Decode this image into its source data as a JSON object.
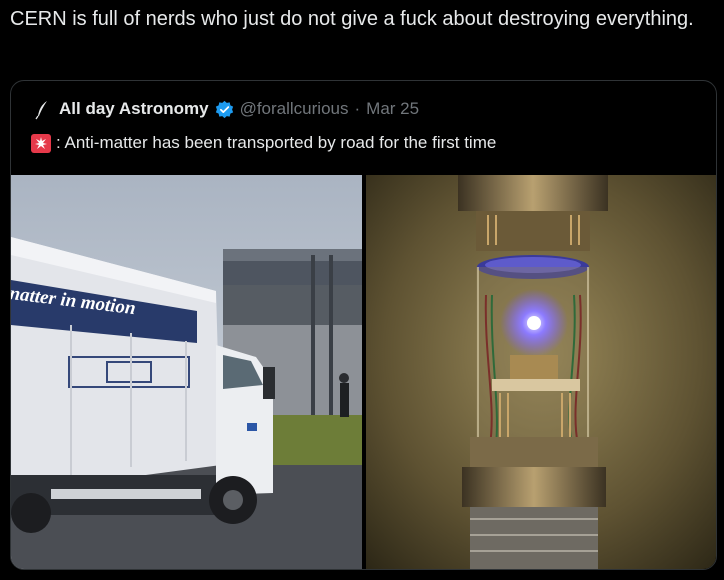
{
  "post": {
    "text": "CERN is full of nerds who just do not give a fuck about destroying everything."
  },
  "quote": {
    "author_name": "All day Astronomy",
    "handle": "@forallcurious",
    "separator": "·",
    "date": "Mar 25",
    "siren_icon": "police-siren-emoji",
    "text": ": Anti-matter has been transported by road for the first time"
  },
  "media": {
    "left_truck_sign": "natter in motion",
    "left_alt": "truck photo",
    "right_alt": "antimatter trap photo"
  },
  "colors": {
    "background": "#000000",
    "text": "#e7e9ea",
    "muted": "#71767b",
    "border": "#2f3336",
    "verified": "#1d9bf0",
    "siren": "#e6394a"
  }
}
